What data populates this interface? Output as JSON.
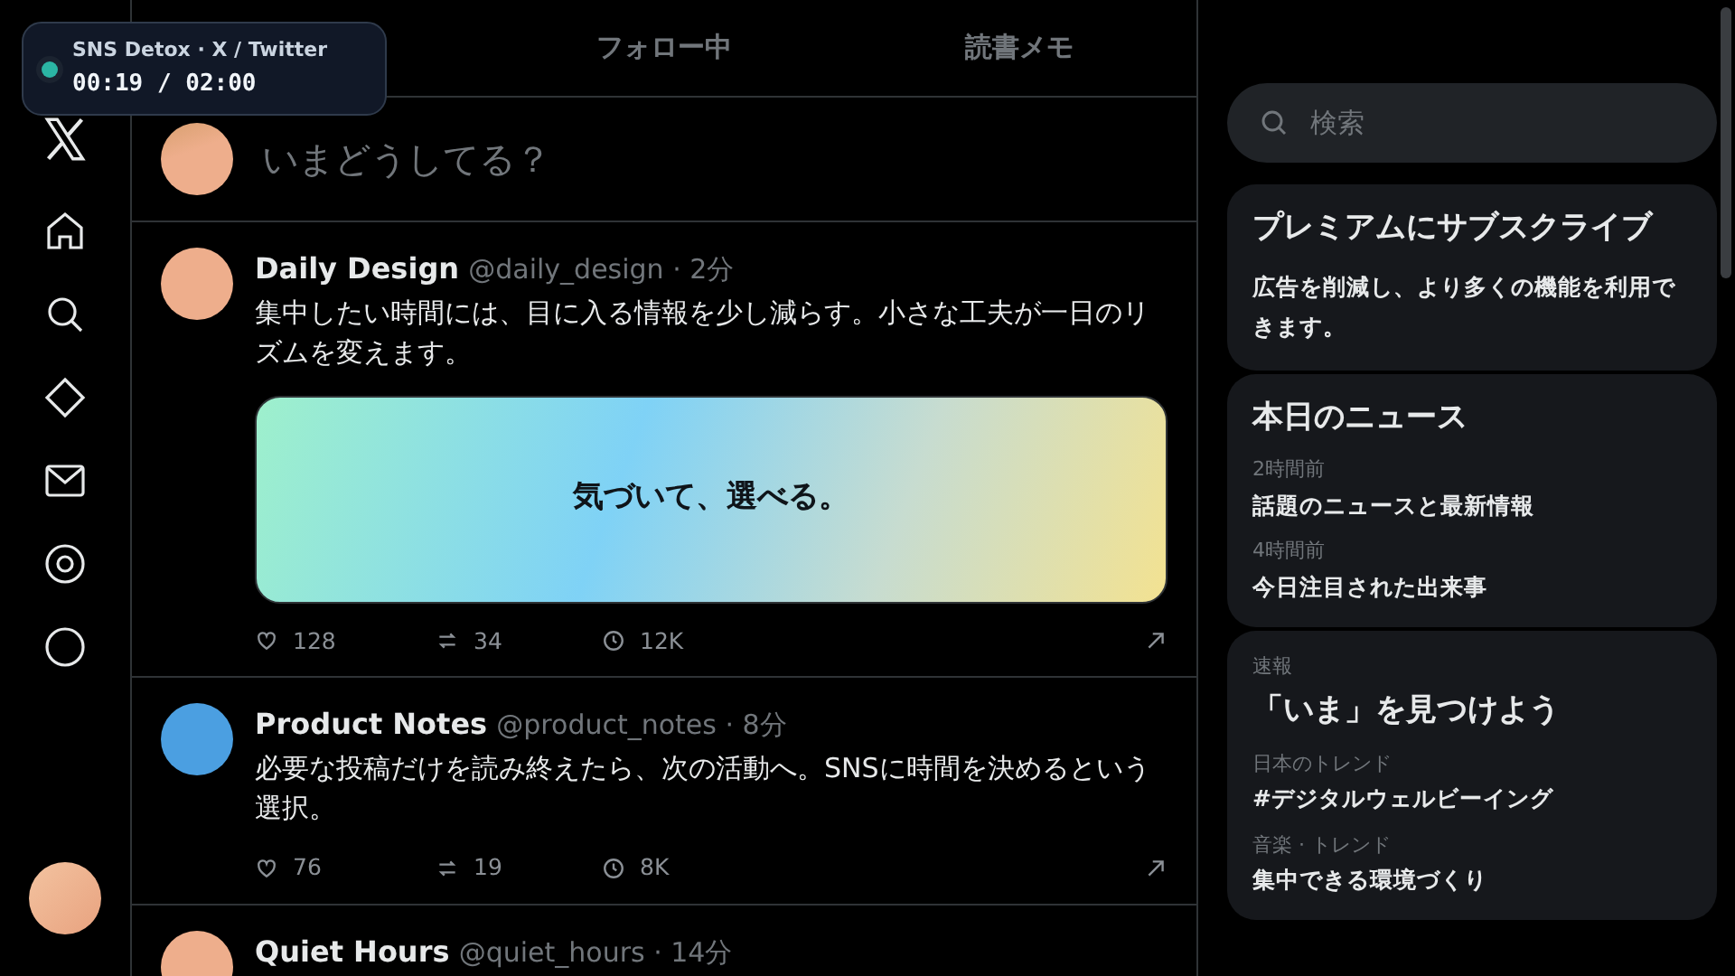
{
  "timer": {
    "title": "SNS Detox · X / Twitter",
    "time": "00:19 / 02:00",
    "active": true,
    "color": "#2bb5a4"
  },
  "tabs": [
    {
      "label": "フォロー中",
      "selected": false
    },
    {
      "label": "読書メモ",
      "selected": false
    }
  ],
  "composer": {
    "placeholder": "いまどうしてる？"
  },
  "posts": [
    {
      "name": "Daily Design",
      "handle": "@daily_design · 2分",
      "color": "#eeae8c",
      "text": "集中したい時間には、目に入る情報を少し減らす。小さな工夫が一日のリズムを変えます。",
      "card": "気づいて、選べる。",
      "likes": "128",
      "reposts": "34",
      "views": "12K"
    },
    {
      "name": "Product Notes",
      "handle": "@product_notes · 8分",
      "color": "#4b9fe1",
      "text": "必要な投稿だけを読み終えたら、次の活動へ。SNSに時間を決めるという選択。",
      "likes": "76",
      "reposts": "19",
      "views": "8K"
    },
    {
      "name": "Quiet Hours",
      "handle": "@quiet_hours · 14分",
      "color": "#eeae8c"
    }
  ],
  "search": {
    "placeholder": "検索"
  },
  "premium": {
    "title": "プレミアムにサブスクライブ",
    "body": "広告を削減し、より多くの機能を利用できます。"
  },
  "news": {
    "title": "本日のニュース",
    "items": [
      {
        "time": "2時間前",
        "headline": "話題のニュースと最新情報"
      },
      {
        "time": "4時間前",
        "headline": "今日注目された出来事"
      }
    ]
  },
  "trends": {
    "label": "速報",
    "title": "「いま」を見つけよう",
    "items": [
      {
        "category": "日本のトレンド",
        "topic": "#デジタルウェルビーイング"
      },
      {
        "category": "音楽 · トレンド",
        "topic": "集中できる環境づくり"
      }
    ]
  }
}
